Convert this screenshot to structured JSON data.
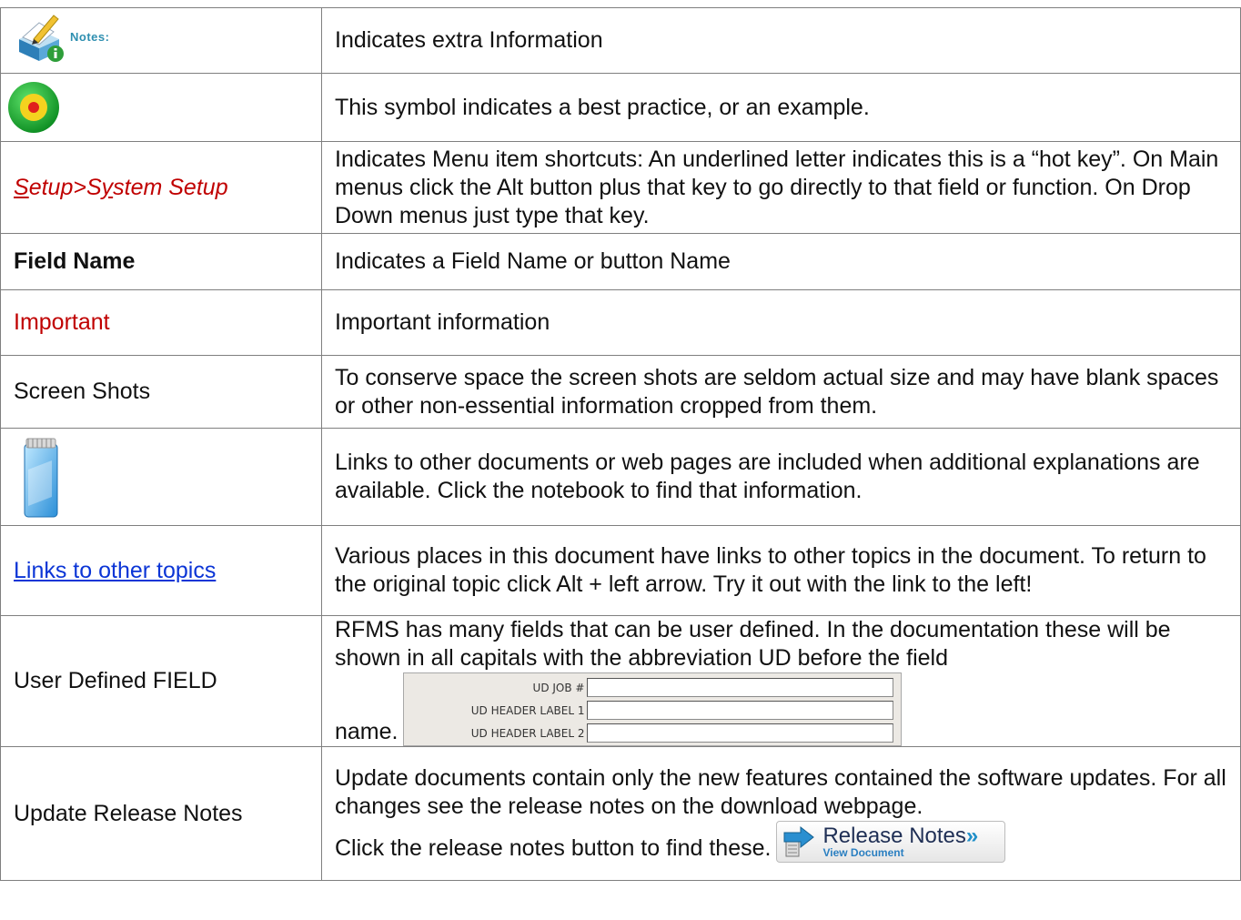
{
  "rows": [
    {
      "term_icon": "notes-icon",
      "term_icon_text": "Notes:",
      "description": "Indicates extra Information"
    },
    {
      "term_icon": "target-icon",
      "description": "This symbol indicates a best practice, or an example."
    },
    {
      "term_parts": [
        "S",
        "etup>",
        "S",
        "y",
        "stem Setup"
      ],
      "description": "Indicates Menu item shortcuts: An underlined letter indicates this is a “hot key”. On Main menus click the Alt button plus that key to go directly to that field or function. On Drop Down menus just type that key."
    },
    {
      "term": "Field Name",
      "description": "Indicates a Field Name or button Name"
    },
    {
      "term": "Important",
      "description": "Important information"
    },
    {
      "term": "Screen Shots",
      "description": "To conserve space the screen shots are seldom actual size and may have blank spaces or other non-essential information cropped from them."
    },
    {
      "term_icon": "notebook-icon",
      "description": "Links to other documents or web pages are included when additional explanations are available. Click the notebook to find that information."
    },
    {
      "term": "Links to other topics",
      "description": "Various places in this document have links to other topics in the document. To return to the original topic click Alt + left arrow. Try it out with the link to the left!"
    },
    {
      "term": "User Defined FIELD",
      "description": "RFMS has many fields that can be user defined. In the documentation these will be shown in all capitals with the abbreviation UD before the field",
      "description_end": "name.",
      "ud_labels": [
        "UD JOB #",
        "UD HEADER LABEL 1",
        "UD HEADER LABEL 2"
      ]
    },
    {
      "term": "Update Release Notes",
      "description": "Update documents contain only the new features contained the software updates. For all changes see the release notes on the download webpage.",
      "description_end": "Click the release notes button to find these.",
      "button_title": "Release Notes",
      "button_arrows": "»",
      "button_sub": "View Document"
    }
  ],
  "colors": {
    "important": "#c00000",
    "link": "#0b35d6",
    "border": "#7f7f7f"
  }
}
